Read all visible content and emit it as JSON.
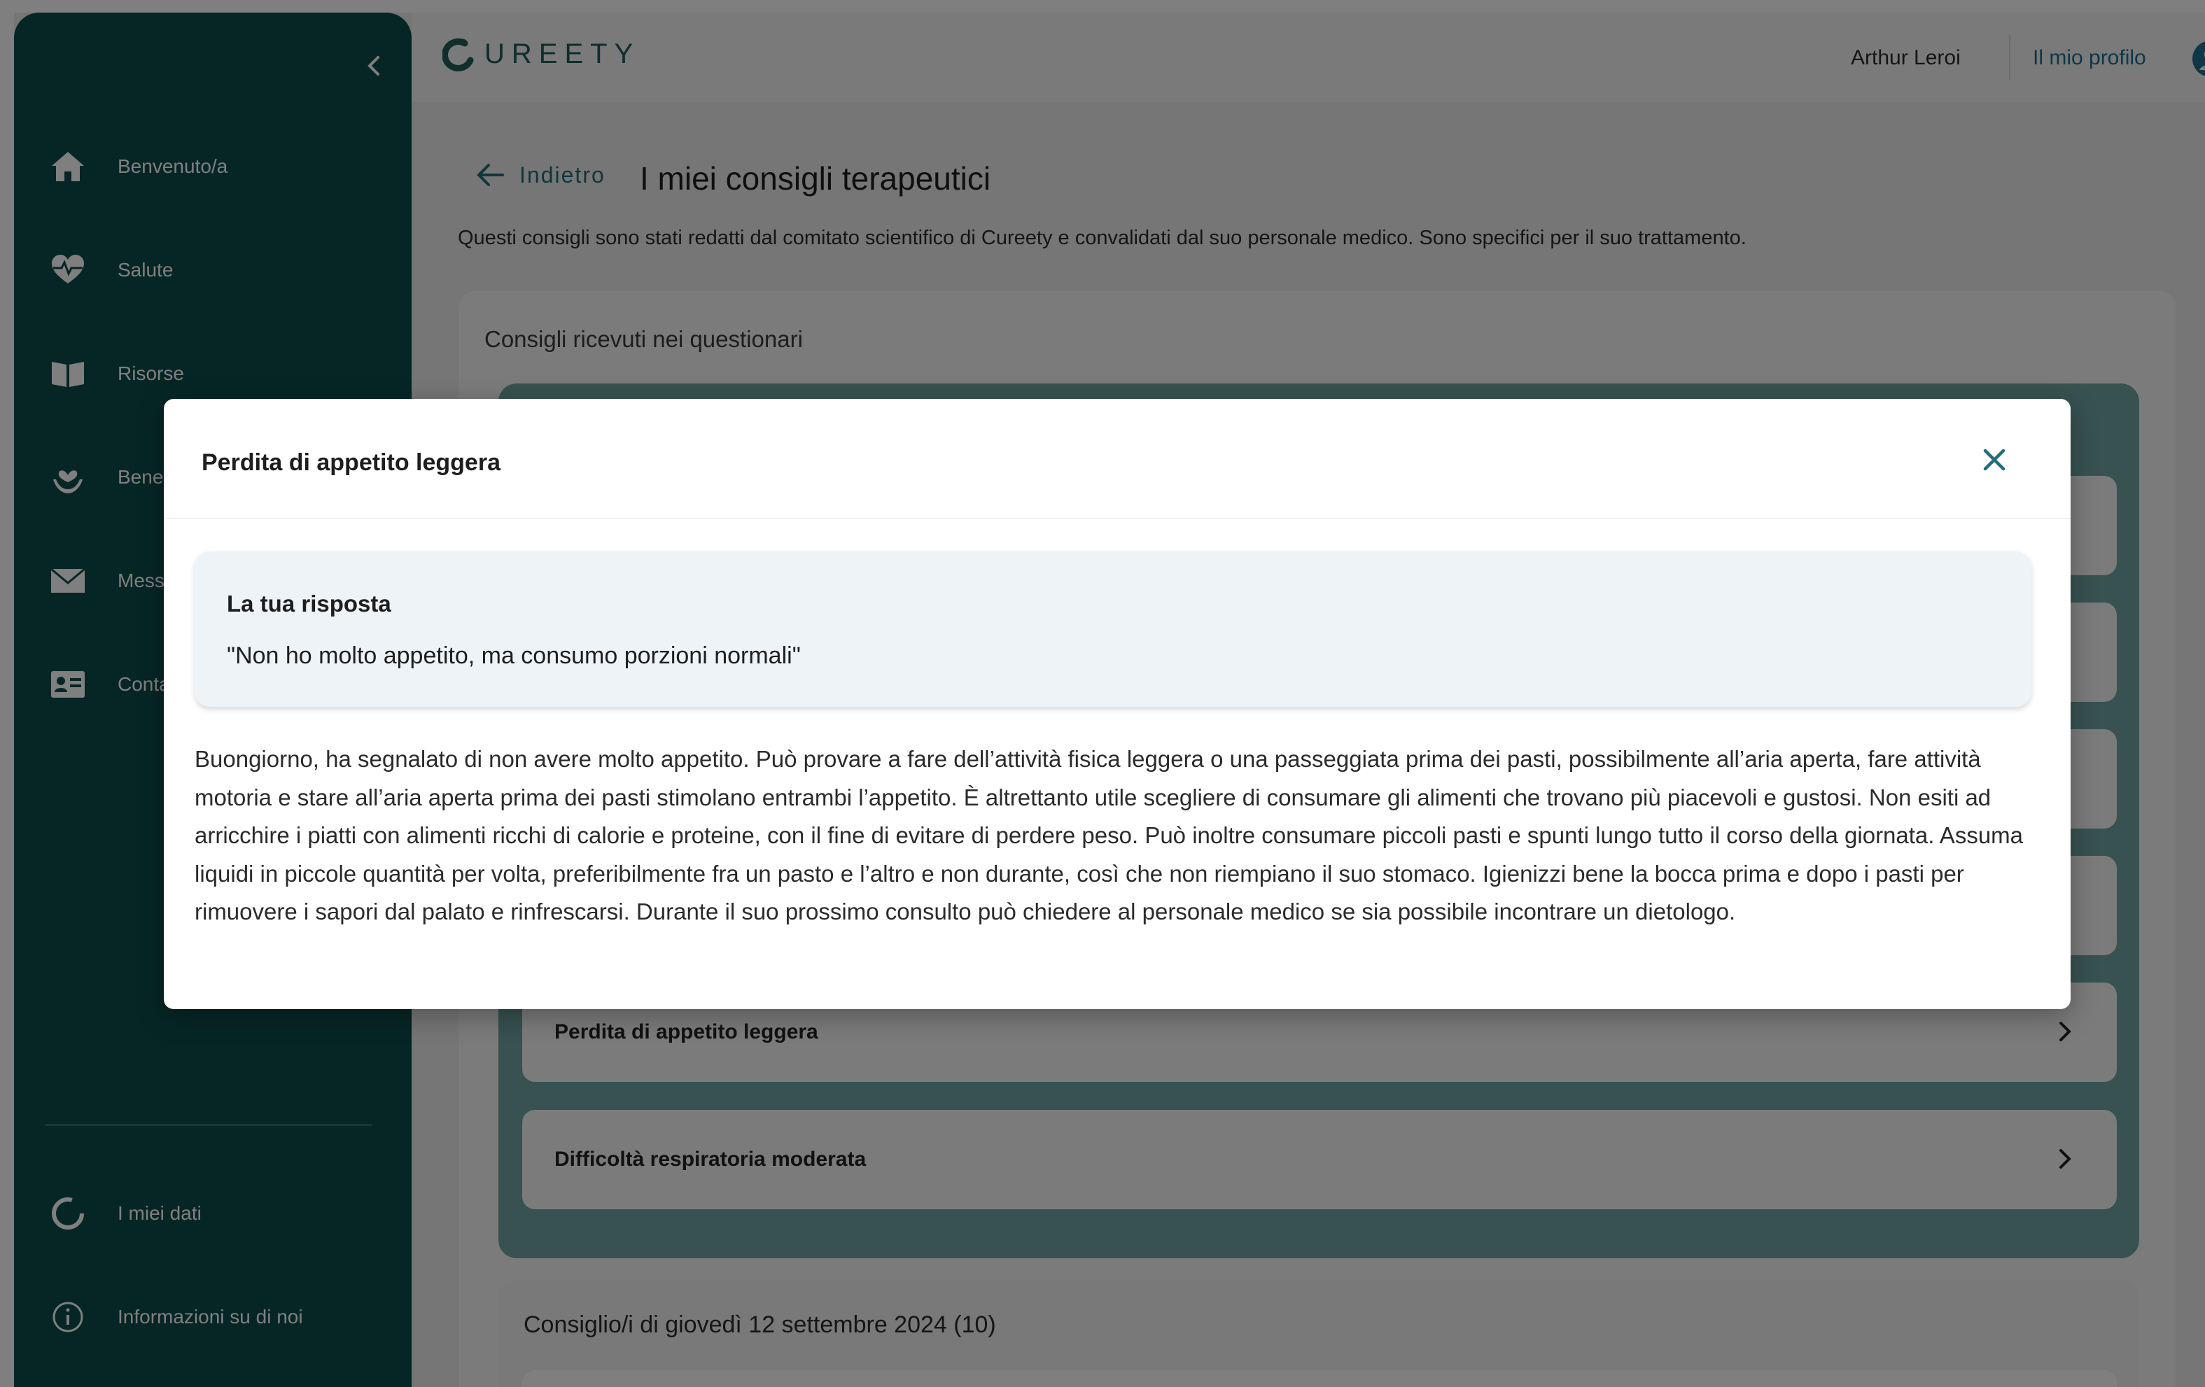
{
  "app": {
    "logo_text": "UREETY",
    "user_name": "Arthur  Leroi",
    "profile_link": "Il mio profilo"
  },
  "sidebar": {
    "items": [
      {
        "label": "Benvenuto/a",
        "icon": "home-icon"
      },
      {
        "label": "Salute",
        "icon": "heart-pulse-icon"
      },
      {
        "label": "Risorse",
        "icon": "book-icon"
      },
      {
        "label": "Bene",
        "icon": "wellbeing-icon"
      },
      {
        "label": "Mess",
        "icon": "mail-icon"
      },
      {
        "label": "Conta",
        "icon": "contact-card-icon"
      }
    ],
    "bottom_items": [
      {
        "label": "I miei dati",
        "icon": "data-icon"
      },
      {
        "label": "Informazioni su di noi",
        "icon": "info-icon"
      }
    ]
  },
  "page": {
    "back_label": "Indietro",
    "title": "I miei consigli terapeutici",
    "description": "Questi consigli sono stati redatti dal comitato scientifico di Cureety e convalidati dal suo personale medico. Sono specifici per il suo trattamento.",
    "card_title": "Consigli ricevuti nei questionari",
    "rows": [
      {
        "label": "Perdita di appetito leggera"
      },
      {
        "label": "Difficoltà respiratoria moderata"
      }
    ],
    "section2_title": "Consiglio/i di giovedì 12 settembre 2024 (10)"
  },
  "modal": {
    "title": "Perdita di appetito leggera",
    "answer_title": "La tua risposta",
    "answer_text": "\"Non ho molto appetito, ma consumo porzioni normali\"",
    "body": "Buongiorno, ha segnalato di non avere molto appetito. Può provare a fare dell’attività fisica leggera o una passeggiata prima dei pasti, possibilmente all’aria aperta, fare attività motoria e stare all’aria aperta prima dei pasti stimolano entrambi l’appetito. È altrettanto utile scegliere di consumare gli alimenti che trovano più piacevoli e gustosi. Non esiti ad arricchire i piatti con alimenti ricchi di calorie e proteine, con il fine di evitare di perdere peso. Può inoltre consumare piccoli pasti e spunti lungo tutto il corso della giornata. Assuma liquidi in piccole quantità per volta, preferibilmente fra un pasto e l’altro e non durante, così che non riempiano il suo stomaco. Igienizzi bene la bocca prima e dopo i pasti per rimuovere i sapori dal palato e rinfrescarsi. Durante il suo prossimo consulto può chiedere al personale medico se sia possibile incontrare un dietologo."
  },
  "colors": {
    "sidebar": "#0d4d4a",
    "accent": "#1f6f7a",
    "group_bg": "#6fa5a2"
  }
}
